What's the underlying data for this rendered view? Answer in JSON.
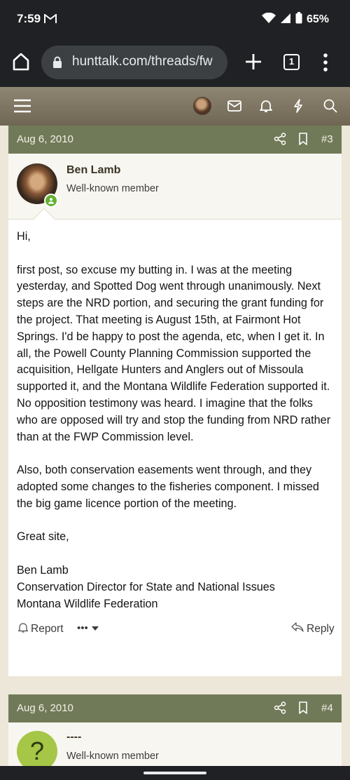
{
  "status_bar": {
    "time": "7:59",
    "battery": "65%"
  },
  "browser": {
    "url": "hunttalk.com/threads/fw",
    "tab_count": "1"
  },
  "posts": [
    {
      "date": "Aug 6, 2010",
      "number": "#3",
      "author": "Ben Lamb",
      "user_title": "Well-known member",
      "paragraphs": [
        "Hi,",
        "first post, so excuse my butting in. I was at the meeting yesterday, and Spotted Dog went through unanimously. Next steps are the NRD portion, and securing the grant funding for the project. That meeting is August 15th, at Fairmont Hot Springs. I'd be happy to post the agenda, etc, when I get it. In all, the Powell County Planning Commission supported the acquisition, Hellgate Hunters and Anglers out of Missoula supported it, and the Montana Wildlife Federation supported it. No opposition testimony was heard. I imagine that the folks who are opposed will try and stop the funding from NRD rather than at the FWP Commission level.",
        "Also, both conservation easements went through, and they adopted some changes to the fisheries component. I missed the big game licence portion of the meeting.",
        "Great site,",
        "Ben Lamb",
        "Conservation Director for State and National Issues",
        "Montana Wildlife Federation"
      ],
      "actions": {
        "report": "Report",
        "reply": "Reply",
        "more": "•••"
      }
    },
    {
      "date": "Aug 6, 2010",
      "number": "#4",
      "author": "----",
      "user_title": "Well-known member",
      "avatar_letter": "?"
    }
  ],
  "colors": {
    "post_header": "#717a58",
    "nav_bar": "#7d7562",
    "online": "#63b132",
    "avatar_unknown": "#a5c646"
  }
}
